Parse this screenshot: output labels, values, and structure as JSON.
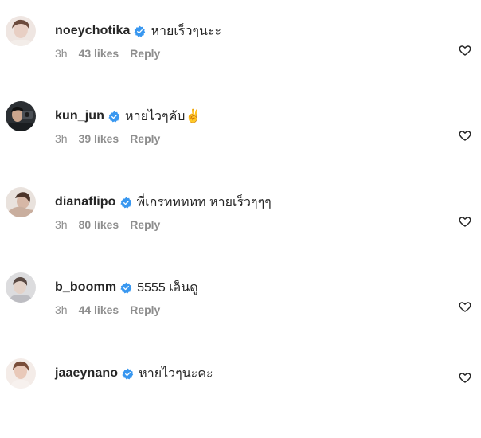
{
  "comments": [
    {
      "username": "noeychotika",
      "text": "หายเร็วๆนะะ",
      "time": "3h",
      "likes": "43 likes",
      "reply": "Reply",
      "avatar_tone": "#e8cfc4"
    },
    {
      "username": "kun_jun",
      "text": "หายไวๆคับ✌️",
      "time": "3h",
      "likes": "39 likes",
      "reply": "Reply",
      "avatar_tone": "#3a3f44"
    },
    {
      "username": "dianaflipo",
      "text": "พี่เกรททททท หายเร็วๆๆๆ",
      "time": "3h",
      "likes": "80 likes",
      "reply": "Reply",
      "avatar_tone": "#d6c2b6"
    },
    {
      "username": "b_boomm",
      "text": "5555 เอ็นดู",
      "time": "3h",
      "likes": "44 likes",
      "reply": "Reply",
      "avatar_tone": "#cfcfd2"
    },
    {
      "username": "jaaeynano",
      "text": "หายไวๆนะคะ",
      "time": "",
      "likes": "",
      "reply": "",
      "avatar_tone": "#e9c9b9"
    }
  ],
  "icons": {
    "verified": "verified-badge-icon",
    "like": "heart-outline-icon"
  },
  "colors": {
    "verified_blue": "#3897f0",
    "muted": "#8e8e8e",
    "text": "#262626"
  }
}
